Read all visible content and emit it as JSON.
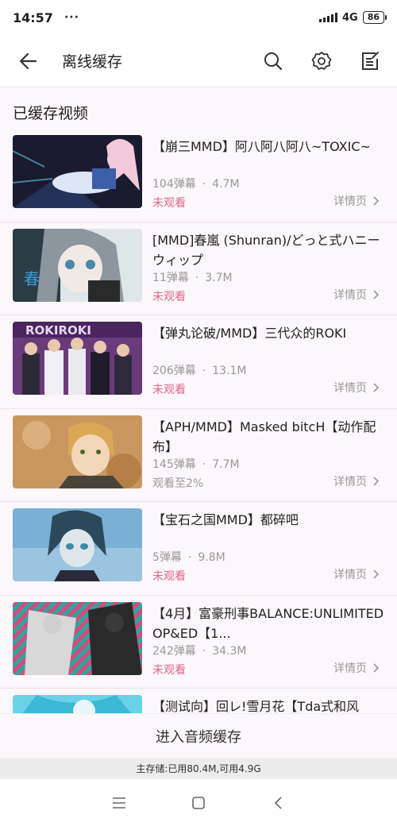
{
  "status_bar": {
    "time": "14:57",
    "dots": "···",
    "network": "4G",
    "battery": "86"
  },
  "app_bar": {
    "title": "离线缓存"
  },
  "section": {
    "title": "已缓存视频"
  },
  "videos": [
    {
      "title": "【崩三MMD】阿八阿八阿八~TOXIC~",
      "danmaku": "104弹幕",
      "size": "4.7M",
      "status": "未观看",
      "status_color": "#e0678e",
      "detail": "详情页"
    },
    {
      "title": "[MMD]春嵐 (Shunran)/どっと式ハニーウィップ",
      "danmaku": "11弹幕",
      "size": "3.7M",
      "status": "未观看",
      "status_color": "#e0678e",
      "detail": "详情页"
    },
    {
      "title": "【弹丸论破/MMD】三代众的ROKI",
      "danmaku": "206弹幕",
      "size": "13.1M",
      "status": "未观看",
      "status_color": "#e0678e",
      "detail": "详情页"
    },
    {
      "title": "【APH/MMD】Masked bitcH【动作配布】",
      "danmaku": "145弹幕",
      "size": "7.7M",
      "status": "观看至2%",
      "status_color": "#999999",
      "detail": "详情页"
    },
    {
      "title": "【宝石之国MMD】都碎吧",
      "danmaku": "5弹幕",
      "size": "9.8M",
      "status": "未观看",
      "status_color": "#e0678e",
      "detail": "详情页"
    },
    {
      "title": "【4月】富豪刑事BALANCE:UNLIMITED OP&ED【1...",
      "danmaku": "242弹幕",
      "size": "34.3M",
      "status": "未观看",
      "status_color": "#e0678e",
      "detail": "详情页"
    },
    {
      "title": "【测试向】回レ!雪月花【Tda式和风",
      "danmaku": "",
      "size": "",
      "status": "",
      "status_color": "#e0678e",
      "detail": ""
    }
  ],
  "thumb_texts": {
    "v2": "春",
    "v3": "ROKIROKI"
  },
  "bottom": {
    "audio_cache": "进入音频缓存",
    "storage": "主存储:已用80.4M,可用4.9G"
  },
  "colors": {
    "accent": "#e0678e",
    "background": "#fbf7fa"
  }
}
